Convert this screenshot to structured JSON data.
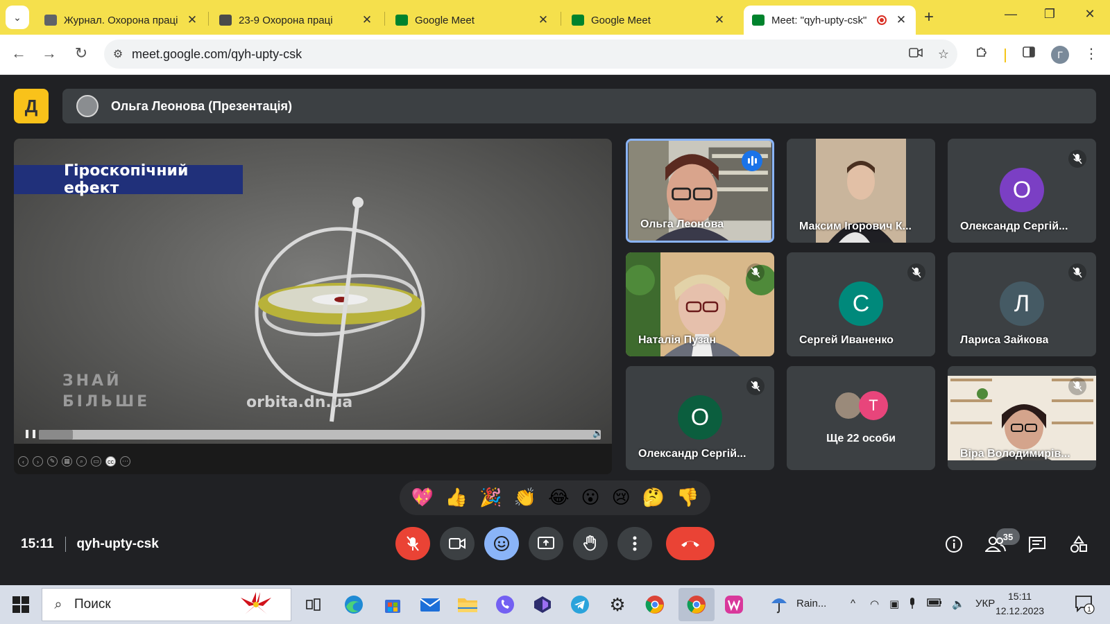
{
  "browser": {
    "tabs": [
      {
        "title": "Журнал. Охорона праці",
        "favicon_color": "#5f6368"
      },
      {
        "title": "23-9 Охорона праці",
        "favicon_color": "#4a4a4a"
      },
      {
        "title": "Google Meet",
        "favicon_color": "#00832d"
      },
      {
        "title": "Google Meet",
        "favicon_color": "#00832d"
      },
      {
        "title": "Meet: \"qyh-upty-csk\"",
        "favicon_color": "#00832d"
      }
    ],
    "url": "meet.google.com/qyh-upty-csk",
    "profile_initial": "Г"
  },
  "meet": {
    "presenter_name": "Ольга Леонова (Презентація)",
    "presentation": {
      "title": "Гіроскопічний ефект",
      "watermark": "orbita.dn.ua",
      "logo_line1": "ЗНАЙ",
      "logo_line2": "БІЛЬШЕ",
      "progress": 0.06
    },
    "participants": [
      {
        "name": "Ольга Леонова",
        "type": "video",
        "speaking": true,
        "muted": false
      },
      {
        "name": "Максим Ігорович К...",
        "type": "video",
        "muted": false
      },
      {
        "name": "Олександр Сергій...",
        "type": "avatar",
        "initial": "О",
        "color": "#7b3fc4",
        "muted": true
      },
      {
        "name": "Наталія Пузан",
        "type": "video",
        "muted": true
      },
      {
        "name": "Сергей Иваненко",
        "type": "avatar",
        "initial": "С",
        "color": "#00897b",
        "muted": true
      },
      {
        "name": "Лариса Зайкова",
        "type": "avatar",
        "initial": "Л",
        "color": "#455a64",
        "muted": true
      },
      {
        "name": "Олександр Сергій...",
        "type": "avatar",
        "initial": "О",
        "color": "#0b5e3e",
        "muted": true
      },
      {
        "name": "Віра Володимирів...",
        "type": "video",
        "muted": true
      }
    ],
    "more": {
      "initial": "Т",
      "label": "Ще 22 особи"
    },
    "reactions": [
      "💖",
      "👍",
      "🎉",
      "👏",
      "😂",
      "😮",
      "😢",
      "🤔",
      "👎"
    ],
    "time": "15:11",
    "meeting_code": "qyh-upty-csk",
    "participant_count": "35"
  },
  "taskbar": {
    "search_placeholder": "Поиск",
    "weather": "Rain...",
    "language": "УКР",
    "time": "15:11",
    "date": "12.12.2023",
    "notifications": "1"
  }
}
